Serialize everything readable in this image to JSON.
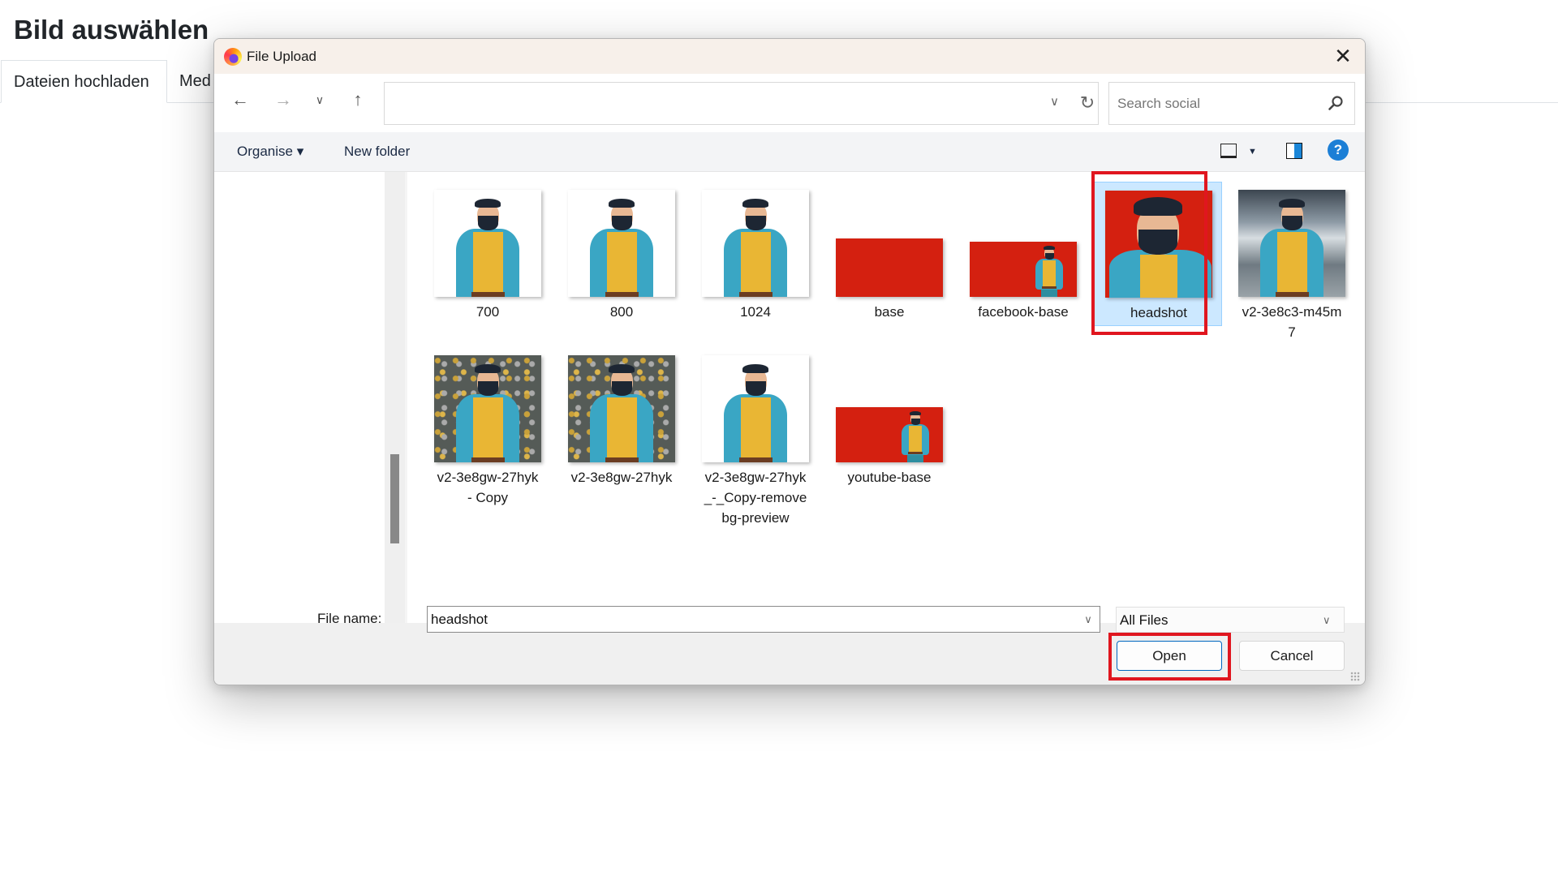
{
  "page": {
    "title": "Bild auswählen",
    "tabs": [
      {
        "label": "Dateien hochladen",
        "active": true
      },
      {
        "label": "Med",
        "active": false
      }
    ]
  },
  "dialog": {
    "title": "File Upload",
    "app_icon": "firefox-icon",
    "close_icon": "close-icon",
    "nav": {
      "back_icon": "←",
      "forward_icon": "→",
      "recent_icon": "⌄",
      "up_icon": "↑"
    },
    "address": {
      "value": "",
      "dropdown_icon": "⌄",
      "refresh_icon": "↻"
    },
    "search": {
      "placeholder": "Search social",
      "value": ""
    },
    "commands": {
      "organise": "Organise ▾",
      "new_folder": "New folder",
      "view_dropdown": "▼",
      "help": "?"
    },
    "files": [
      {
        "name": "700",
        "thumb": "person-white",
        "selected": false
      },
      {
        "name": "800",
        "thumb": "person-white",
        "selected": false
      },
      {
        "name": "1024",
        "thumb": "person-white",
        "selected": false
      },
      {
        "name": "base",
        "thumb": "red-banner",
        "selected": false
      },
      {
        "name": "facebook-base",
        "thumb": "red-banner-person",
        "selected": false
      },
      {
        "name": "headshot",
        "thumb": "red-headshot",
        "selected": true
      },
      {
        "name": "v2-3e8c3-m45m7",
        "thumb": "photo-person",
        "selected": false
      },
      {
        "name": "v2-3e8gw-27hyk - Copy",
        "thumb": "pattern-person",
        "selected": false
      },
      {
        "name": "v2-3e8gw-27hyk",
        "thumb": "pattern-person",
        "selected": false
      },
      {
        "name": "v2-3e8gw-27hyk_-_Copy-removebg-preview",
        "thumb": "person-white",
        "selected": false
      },
      {
        "name": "youtube-base",
        "thumb": "red-banner-person",
        "selected": false
      }
    ],
    "file_labels_wrapped": {
      "f6": "v2-3e8c3-m45m\n7",
      "f7": "v2-3e8gw-27hyk\n- Copy",
      "f9": "v2-3e8gw-27hyk\n_-_Copy-remove\nbg-preview"
    },
    "footer": {
      "file_name_label": "File name:",
      "file_name_value": "headshot",
      "filter_value": "All Files",
      "open_label": "Open",
      "cancel_label": "Cancel"
    }
  },
  "colors": {
    "accent_red": "#d42010",
    "annotation_red": "#e0161f",
    "selection_bg": "#cce8ff",
    "primary_button_border": "#0067c0"
  }
}
